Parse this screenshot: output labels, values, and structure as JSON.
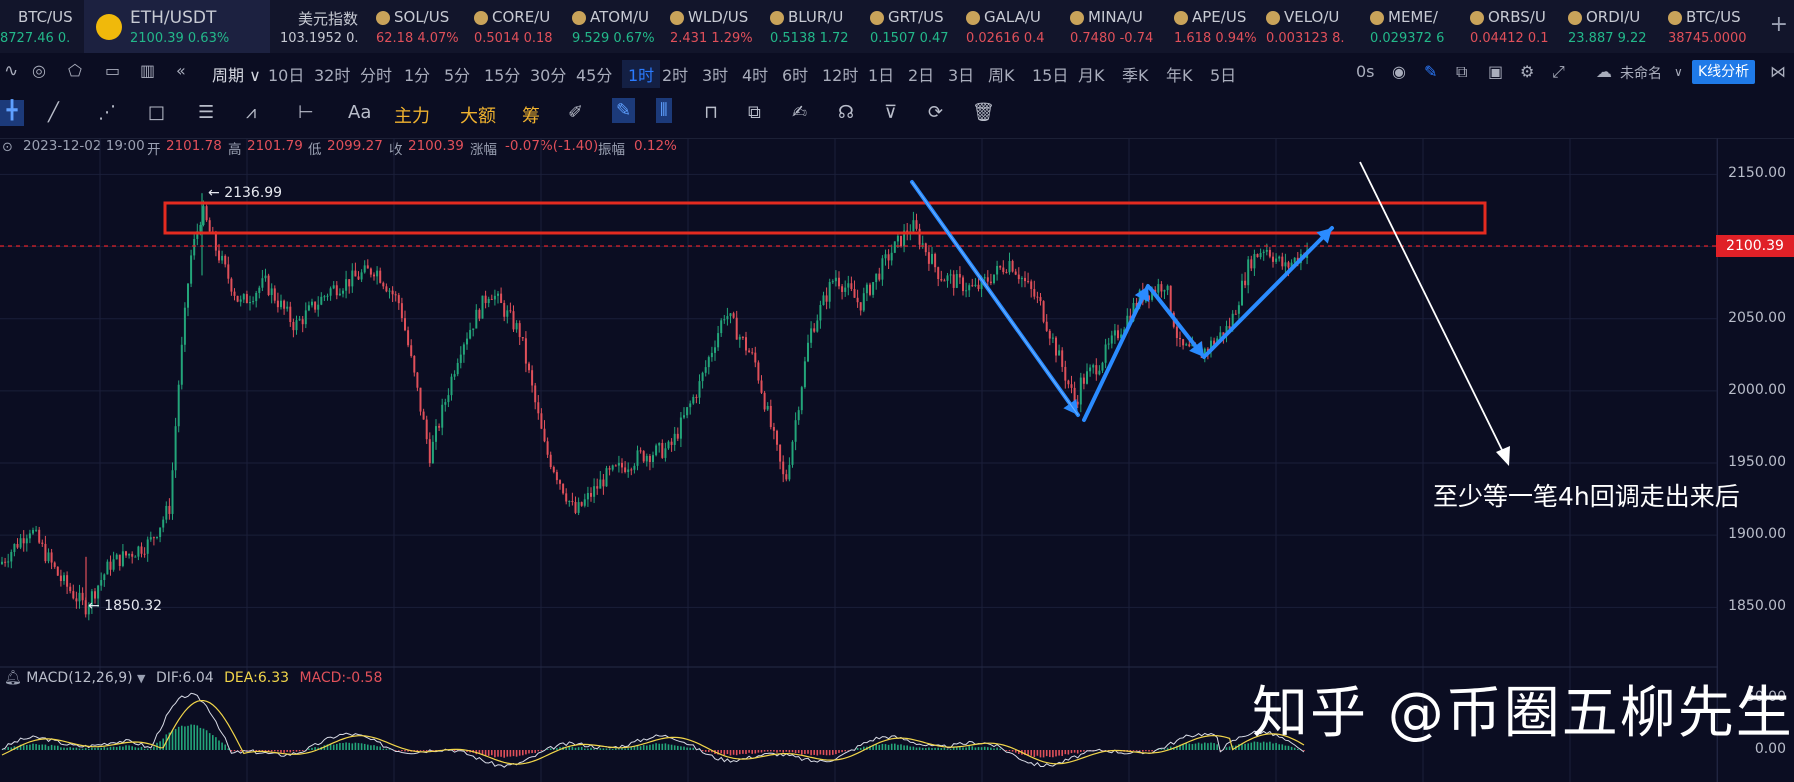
{
  "tickers": [
    {
      "name": "BTC/US",
      "price": "8727.46",
      "change": "0.",
      "up": true
    },
    {
      "name": "ETH/USDT",
      "price": "2100.39",
      "change": "0.63%",
      "up": true,
      "active": true
    },
    {
      "name": "美元指数",
      "price": "103.1952",
      "change": "0.",
      "up": true
    },
    {
      "name": "SOL/US",
      "price": "62.18",
      "change": "4.07%",
      "up": false
    },
    {
      "name": "CORE/U",
      "price": "0.5014",
      "change": "0.18",
      "up": false
    },
    {
      "name": "ATOM/U",
      "price": "9.529",
      "change": "0.67%",
      "up": true
    },
    {
      "name": "WLD/US",
      "price": "2.431",
      "change": "1.29%",
      "up": false
    },
    {
      "name": "BLUR/U",
      "price": "0.5138",
      "change": "1.72",
      "up": true
    },
    {
      "name": "GRT/US",
      "price": "0.1507",
      "change": "0.47",
      "up": true
    },
    {
      "name": "GALA/U",
      "price": "0.02616",
      "change": "0.4",
      "up": false
    },
    {
      "name": "MINA/U",
      "price": "0.7480",
      "change": "-0.74",
      "up": false
    },
    {
      "name": "APE/US",
      "price": "1.618",
      "change": "0.94%",
      "up": false
    },
    {
      "name": "VELO/U",
      "price": "0.003123",
      "change": "8.",
      "up": false
    },
    {
      "name": "MEME/",
      "price": "0.029372",
      "change": "6",
      "up": true
    },
    {
      "name": "ORBS/U",
      "price": "0.04412",
      "change": "0.1",
      "up": false
    },
    {
      "name": "ORDI/U",
      "price": "23.887",
      "change": "9.22",
      "up": true
    },
    {
      "name": "BTC/US",
      "price": "38745.0000",
      "change": "",
      "up": false
    }
  ],
  "periods": [
    "周期",
    "10日",
    "32时",
    "分时",
    "1分",
    "5分",
    "15分",
    "30分",
    "45分",
    "1时",
    "2时",
    "3时",
    "4时",
    "6时",
    "12时",
    "1日",
    "2日",
    "3日",
    "周K",
    "15日",
    "月K",
    "季K",
    "年K",
    "5日"
  ],
  "selected_period": "1时",
  "period_right": {
    "timer": "0s",
    "layout_name": "未命名",
    "kline_button": "K线分析"
  },
  "tools": {
    "font": "Aa",
    "main": "主力",
    "amount": "大额",
    "chips": "筹"
  },
  "ohlc": {
    "time": "2023-12-02 19:00",
    "open_label": "开",
    "open": "2101.78",
    "high_label": "高",
    "high": "2101.79",
    "low_label": "低",
    "low": "2099.27",
    "close_label": "收",
    "close": "2100.39",
    "change_label": "涨幅",
    "change": "-0.07%(-1.40)",
    "amp_label": "振幅",
    "amp": "0.12%"
  },
  "price_axis": {
    "labels": [
      "2150.00",
      "2100.00",
      "2050.00",
      "2000.00",
      "1950.00",
      "1900.00",
      "1850.00"
    ],
    "current": "2100.39"
  },
  "macd": {
    "title": "MACD(12,26,9)",
    "dif": "DIF:6.04",
    "dea": "DEA:6.33",
    "macd": "MACD:-0.58",
    "axis": [
      "50.00",
      "0.00"
    ]
  },
  "high_label": "2136.99",
  "low_label": "1850.32",
  "annotation": "至少等一笔4h回调走出来后",
  "watermark": "知乎 @币圈五柳先生",
  "colors": {
    "up": "#23a57a",
    "down": "#e0505a",
    "resistance": "#e52b20",
    "arrow": "#2a8bff",
    "current": "#e02027"
  }
}
